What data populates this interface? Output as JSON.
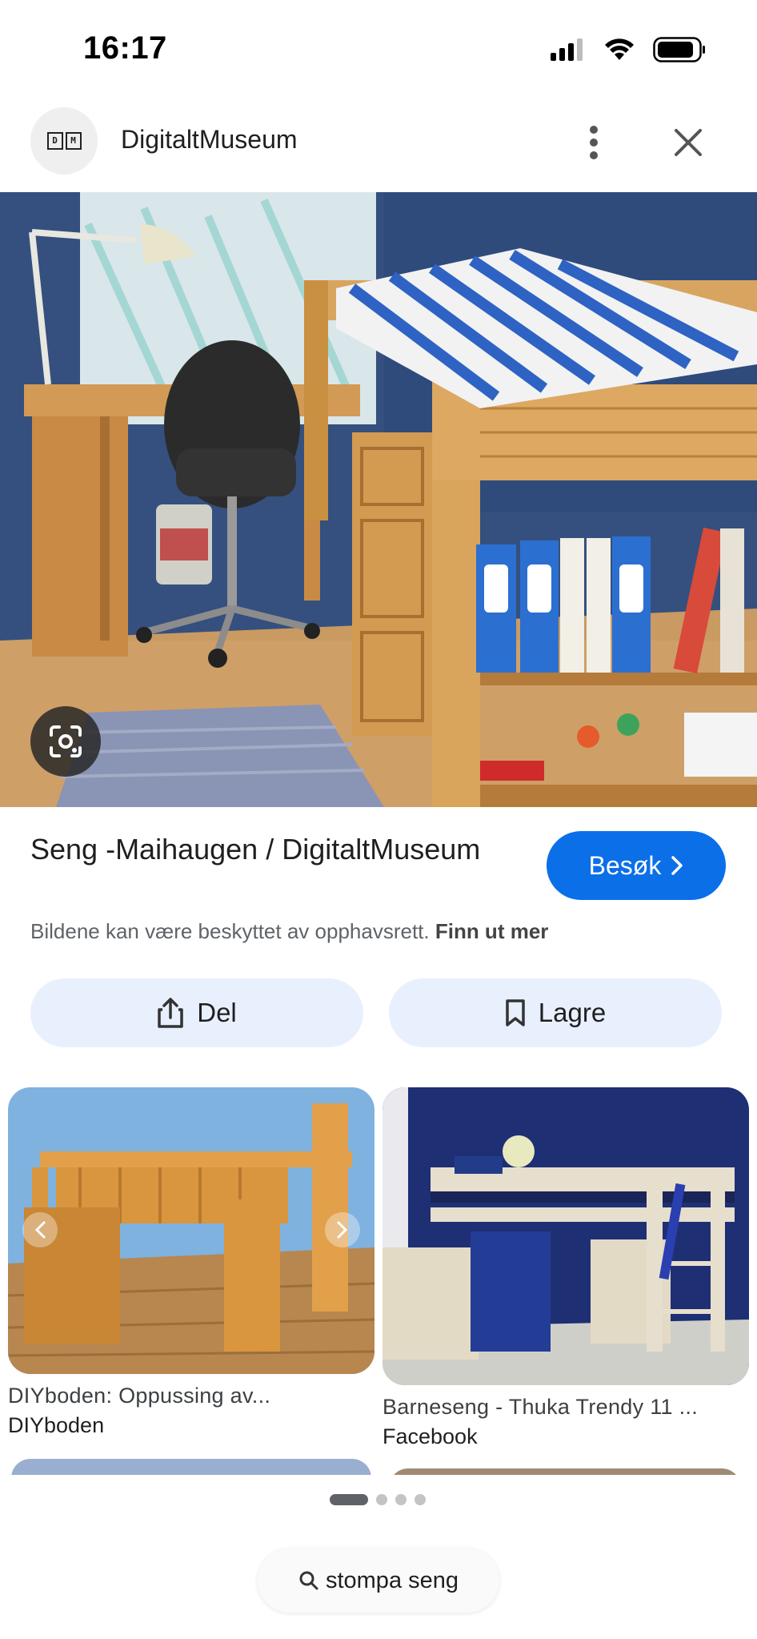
{
  "status_bar": {
    "time": "16:17"
  },
  "header": {
    "site_name": "DigitaltMuseum",
    "logo_letters": [
      "D",
      "M"
    ]
  },
  "main_image": {
    "alt": ""
  },
  "result": {
    "title": "Seng -Maihaugen / DigitaltMuseum",
    "visit_label": "Besøk",
    "copyright_text": "Bildene kan være beskyttet av opphavsrett.",
    "copyright_link": "Finn ut mer"
  },
  "actions": {
    "share_label": "Del",
    "save_label": "Lagre"
  },
  "related": [
    {
      "title": "DIYboden: Oppussing av...",
      "source": "DIYboden"
    },
    {
      "title": "Barneseng - Thuka Trendy 11 ...",
      "source": "Facebook"
    }
  ],
  "search": {
    "query": "stompa seng"
  },
  "colors": {
    "accent": "#0b6fe8",
    "pill_bg": "#e8f0fe"
  }
}
